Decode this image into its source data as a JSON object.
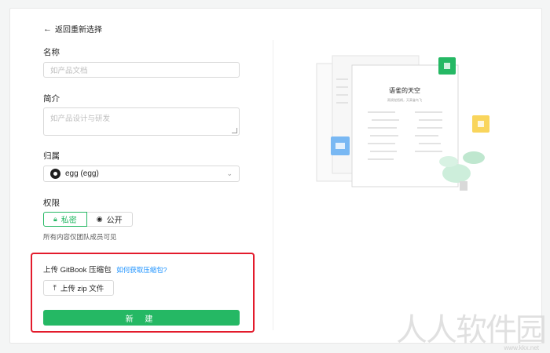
{
  "back_label": "返回重新选择",
  "name": {
    "label": "名称",
    "placeholder": "如产品文档"
  },
  "intro": {
    "label": "简介",
    "placeholder": "如产品设计与研发"
  },
  "owner": {
    "label": "归属",
    "value": "egg (egg)"
  },
  "permission": {
    "label": "权限",
    "options": [
      "私密",
      "公开"
    ],
    "selected": "私密",
    "hint": "所有内容仅团队成员可见"
  },
  "upload": {
    "title": "上传 GitBook 压缩包",
    "help_link": "如何获取压缩包?",
    "button": "上传 zip 文件"
  },
  "create_button": "新 建",
  "illustration": {
    "title": "语雀的天空",
    "subtitle": "雨润觉悟柄，天高雀鸟飞"
  },
  "watermark": "人人软件园",
  "watermark_url": "www.kkx.net",
  "colors": {
    "primary": "#25b864",
    "link": "#1890ff",
    "highlight": "#e31b2c"
  }
}
